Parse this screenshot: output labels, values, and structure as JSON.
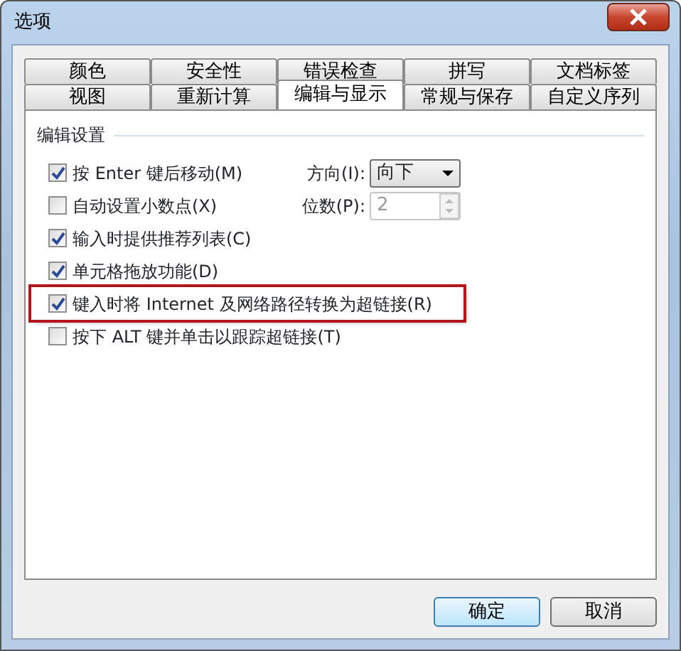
{
  "window": {
    "title": "选项"
  },
  "tab_rows": [
    {
      "tabs": [
        {
          "label": "颜色",
          "selected": false
        },
        {
          "label": "安全性",
          "selected": false
        },
        {
          "label": "错误检查",
          "selected": false
        },
        {
          "label": "拼写",
          "selected": false
        },
        {
          "label": "文档标签",
          "selected": false
        }
      ]
    },
    {
      "tabs": [
        {
          "label": "视图",
          "selected": false
        },
        {
          "label": "重新计算",
          "selected": false
        },
        {
          "label": "编辑与显示",
          "selected": true
        },
        {
          "label": "常规与保存",
          "selected": false
        },
        {
          "label": "自定义序列",
          "selected": false
        }
      ]
    }
  ],
  "section": {
    "title": "编辑设置"
  },
  "options": [
    {
      "label": "按 Enter 键后移动(M)",
      "checked": true,
      "highlighted": false,
      "field": {
        "kind": "select",
        "label": "方向(I):",
        "value": "向下",
        "disabled": false
      }
    },
    {
      "label": "自动设置小数点(X)",
      "checked": false,
      "highlighted": false,
      "field": {
        "kind": "spinner",
        "label": "位数(P):",
        "value": "2",
        "disabled": true
      }
    },
    {
      "label": "输入时提供推荐列表(C)",
      "checked": true,
      "highlighted": false
    },
    {
      "label": "单元格拖放功能(D)",
      "checked": true,
      "highlighted": false
    },
    {
      "label": "键入时将 Internet 及网络路径转换为超链接(R)",
      "checked": true,
      "highlighted": true
    },
    {
      "label": "按下 ALT 键并单击以跟踪超链接(T)",
      "checked": false,
      "highlighted": false
    }
  ],
  "buttons": [
    {
      "label": "确定",
      "default": true
    },
    {
      "label": "取消",
      "default": false
    }
  ]
}
